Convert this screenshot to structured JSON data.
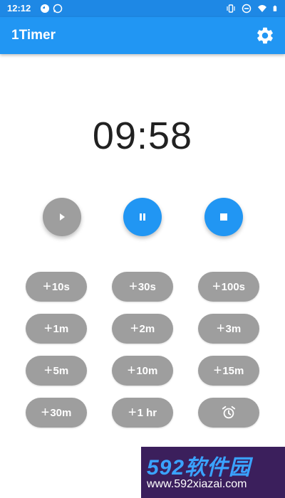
{
  "statusbar": {
    "time": "12:12",
    "icons": [
      "notification-icon",
      "whatsapp-icon",
      "vibrate-icon",
      "dnd-icon",
      "wifi-icon",
      "battery-icon"
    ]
  },
  "appbar": {
    "title": "1Timer",
    "settings_icon": "gear-icon"
  },
  "timer": {
    "display": "09:58"
  },
  "controls": {
    "play_icon": "play-icon",
    "pause_icon": "pause-icon",
    "stop_icon": "stop-icon",
    "play_color": "#9e9e9e",
    "active_color": "#2196f3"
  },
  "add_buttons": [
    {
      "label": "10s"
    },
    {
      "label": "30s"
    },
    {
      "label": "100s"
    },
    {
      "label": "1m"
    },
    {
      "label": "2m"
    },
    {
      "label": "3m"
    },
    {
      "label": "5m"
    },
    {
      "label": "10m"
    },
    {
      "label": "15m"
    },
    {
      "label": "30m"
    },
    {
      "label": "1 hr"
    }
  ],
  "plus_symbol": "+",
  "alarm_icon": "alarm-icon",
  "watermark": {
    "brand": "592软件园",
    "url": "www.592xiazai.com"
  },
  "colors": {
    "appbar": "#2196f3",
    "statusbar": "#1e88e5",
    "button_gray": "#9e9e9e"
  }
}
